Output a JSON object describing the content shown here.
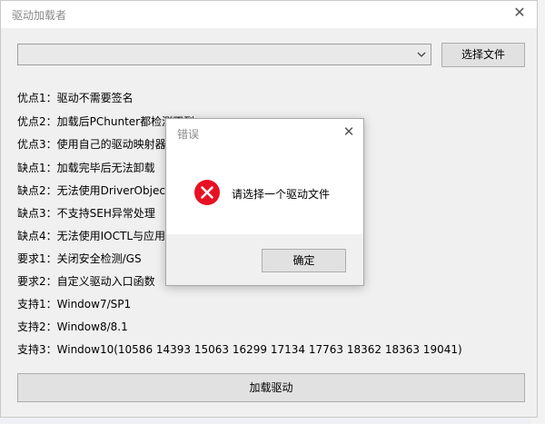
{
  "window": {
    "title": "驱动加载者",
    "close_glyph": "✕"
  },
  "file_select": {
    "value": "",
    "choose_button": "选择文件"
  },
  "info_lines": [
    "优点1：驱动不需要签名",
    "优点2：加载后PChunter都检测不到",
    "优点3：使用自己的驱动映射器",
    "缺点1：加载完毕后无法卸载",
    "缺点2：无法使用DriverObject",
    "缺点3：不支持SEH异常处理",
    "缺点4：无法使用IOCTL与应用通信",
    "要求1：关闭安全检测/GS",
    "要求2：自定义驱动入口函数",
    "支持1：Window7/SP1",
    "支持2：Window8/8.1",
    "支持3：Window10(10586 14393 15063 16299 17134 17763 18362 18363 19041)"
  ],
  "load_button": "加载驱动",
  "dialog": {
    "title": "错误",
    "close_glyph": "✕",
    "message": "请选择一个驱动文件",
    "ok_button": "确定",
    "icon": "error-icon"
  },
  "colors": {
    "error_red": "#e81123",
    "window_bg": "#f0f0f0",
    "title_gray": "#8a8a8a"
  }
}
